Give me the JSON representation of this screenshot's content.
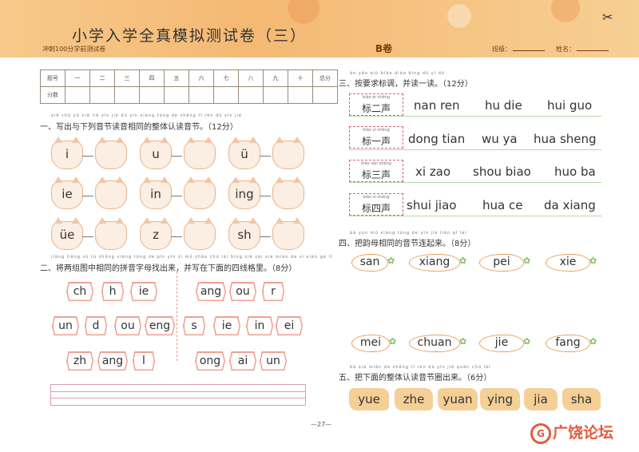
{
  "header": {
    "title": "小学入学全真模拟测试卷（三）",
    "subtitle": "冲刺100分学前测试卷",
    "volume": "B卷",
    "class_label": "班级：",
    "name_label": "姓名："
  },
  "score_table": {
    "row1": [
      "题号",
      "一",
      "二",
      "三",
      "四",
      "五",
      "六",
      "七",
      "八",
      "九",
      "十",
      "总分"
    ],
    "row2_label": "分数"
  },
  "section1": {
    "pinyin": "xiě chū yǔ xià liè yīn jié dú yīn xiāng tóng de zhěng tǐ rèn dú yīn jié",
    "title": "一、写出与下列音节读音相同的整体认读音节。（12分）",
    "items": [
      "i",
      "u",
      "ü",
      "ie",
      "in",
      "ing",
      "üe",
      "z",
      "sh"
    ]
  },
  "section2": {
    "pinyin": "jiāng liǎng zǔ tú zhōng xiāng tóng de pīn yīn zì mǔ zhǎo chū lái bìng xiě zài xià miàn de sì xiàn gé lǐ",
    "title": "二、将两组图中相同的拼音字母找出来，并写在下面的四线格里。（8分）",
    "left_group": [
      [
        "ch",
        "h",
        "ie"
      ],
      [
        "un",
        "d",
        "ou",
        "eng"
      ],
      [
        "zh",
        "ang",
        "l"
      ]
    ],
    "right_group": [
      [
        "ang",
        "ou",
        "r"
      ],
      [
        "s",
        "ie",
        "in",
        "ei"
      ],
      [
        "ong",
        "ai",
        "un"
      ]
    ]
  },
  "section3": {
    "pinyin": "àn yāo qiú biāo diào bìng dú yī dú",
    "title": "三、按要求标调，并读一读。（12分）",
    "rows": [
      {
        "pinyin": "biāo èr shēng",
        "label": "标二声",
        "words": [
          "nan ren",
          "hu die",
          "hui guo"
        ]
      },
      {
        "pinyin": "biāo yī shēng",
        "label": "标一声",
        "words": [
          "dong tian",
          "wu ya",
          "hua sheng"
        ]
      },
      {
        "pinyin": "biāo sān shēng",
        "label": "标三声",
        "words": [
          "xi zao",
          "shou biao",
          "huo ba"
        ]
      },
      {
        "pinyin": "biāo sì shēng",
        "label": "标四声",
        "words": [
          "shui jiao",
          "hua ce",
          "da xiang"
        ]
      }
    ]
  },
  "section4": {
    "pinyin": "bǎ yùn mǔ xiāng tóng de yīn jié lián qǐ lái",
    "title": "四、把韵母相同的音节连起来。（8分）",
    "top": [
      "san",
      "xiang",
      "pei",
      "xie"
    ],
    "bottom": [
      "mei",
      "chuan",
      "jie",
      "fang"
    ]
  },
  "section5": {
    "pinyin": "bǎ xià miàn de zhěng tǐ rèn dú yīn jié quān chū lái",
    "title": "五、把下面的整体认读音节圈出来。（6分）",
    "items": [
      "yue",
      "zhe",
      "yuan",
      "ying",
      "jia",
      "sha"
    ]
  },
  "footer": {
    "page_number": "—27—",
    "logo_letter": "G",
    "logo_text": "广饶论坛"
  },
  "colors": {
    "banner": "#f4b973",
    "tone_border": "#e0607a",
    "line_green": "#b6d8a8",
    "carrot_border": "#e8a060",
    "wave_fill": "#f4cf96",
    "logo": "#e55a3c"
  }
}
